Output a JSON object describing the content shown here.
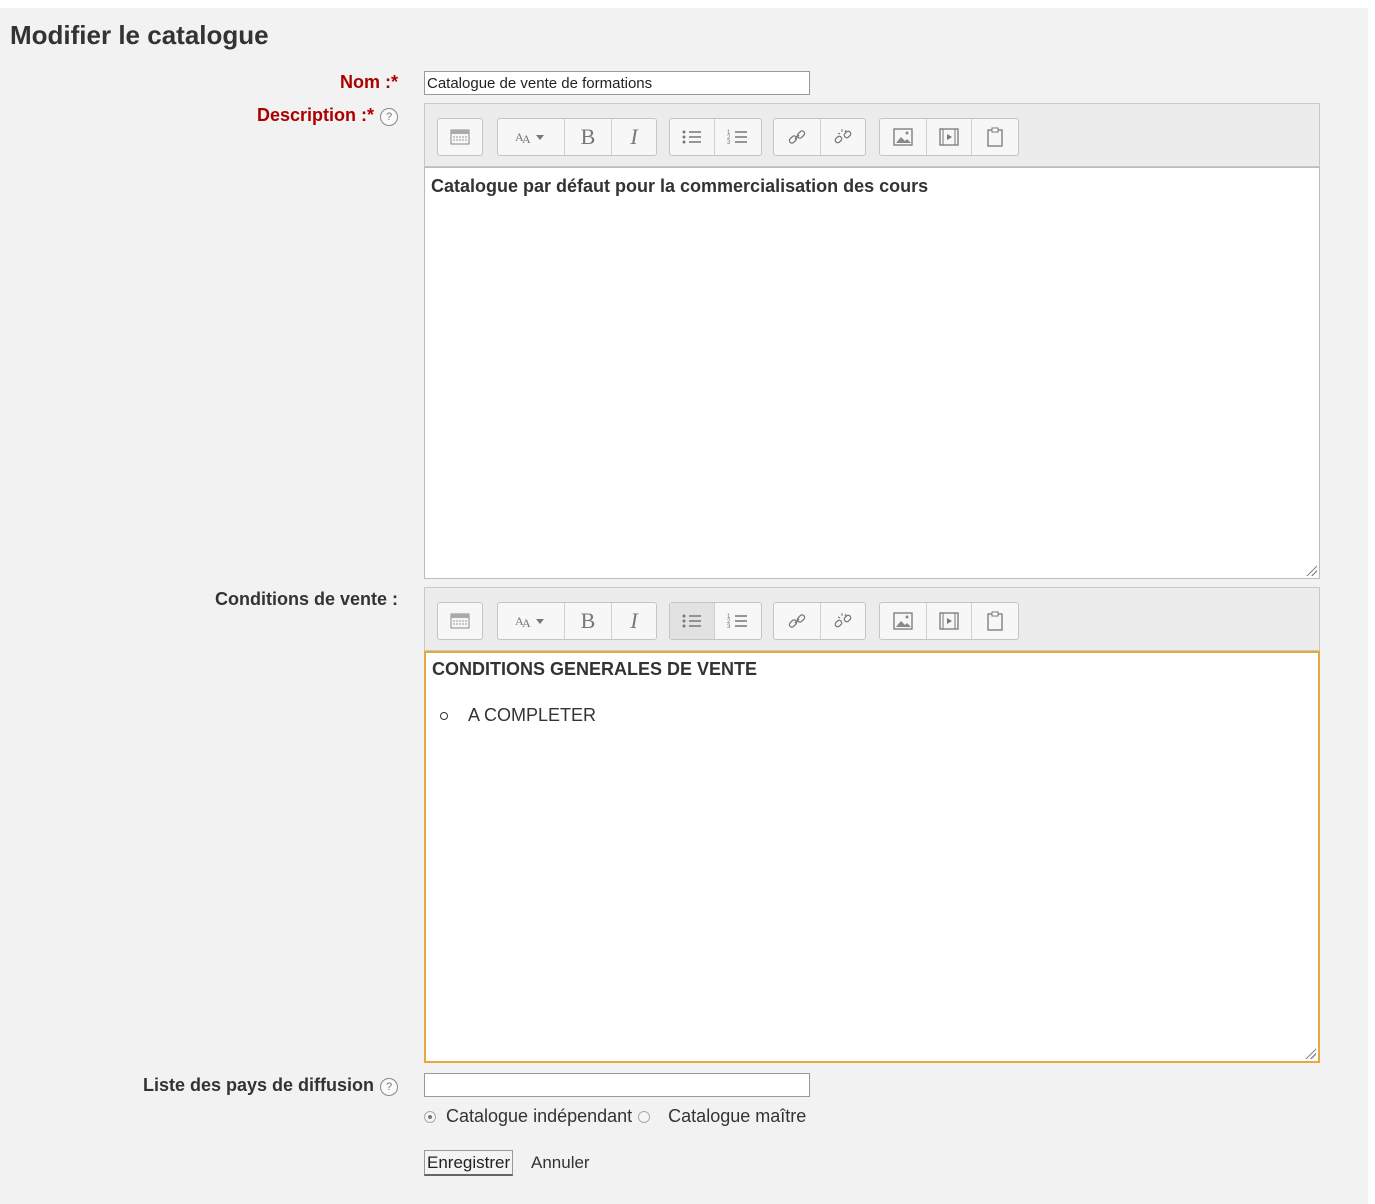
{
  "page": {
    "title": "Modifier le catalogue"
  },
  "form": {
    "nom": {
      "label": "Nom :",
      "required_mark": "*",
      "value": "Catalogue de vente de formations"
    },
    "description": {
      "label": "Description :",
      "required_mark": "*",
      "help_icon": "?",
      "content": "Catalogue par défaut pour la commercialisation des cours"
    },
    "conditions": {
      "label": "Conditions de vente :",
      "heading": "CONDITIONS GENERALES DE VENTE",
      "items": [
        "A COMPLETER"
      ]
    },
    "pays": {
      "label": "Liste des pays de diffusion",
      "help_icon": "?",
      "value": ""
    },
    "catalogue_type": {
      "options": [
        {
          "label": "Catalogue indépendant",
          "checked": true
        },
        {
          "label": "Catalogue maître",
          "checked": false
        }
      ]
    },
    "buttons": {
      "save": "Enregistrer",
      "cancel": "Annuler"
    }
  },
  "toolbar": {
    "icons": [
      "toolbar-toggle-icon",
      "font-style-icon",
      "bold-icon",
      "italic-icon",
      "unordered-list-icon",
      "ordered-list-icon",
      "link-icon",
      "unlink-icon",
      "image-icon",
      "media-icon",
      "paste-icon"
    ],
    "bold_glyph": "B",
    "italic_glyph": "I"
  },
  "colors": {
    "required_label": "#aa0000",
    "focus_border": "#e8a93c"
  }
}
